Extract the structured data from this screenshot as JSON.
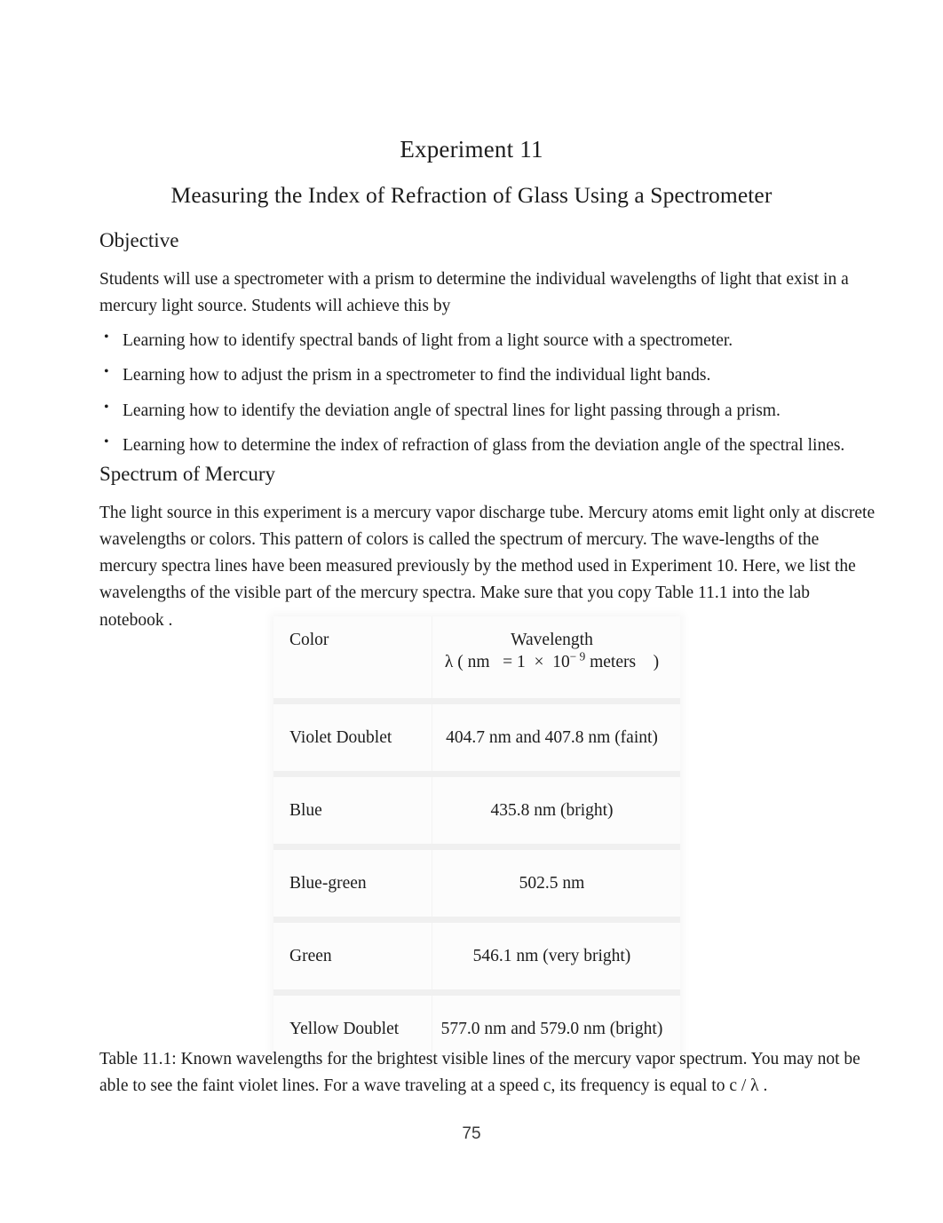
{
  "document": {
    "experiment_title": "Experiment 11",
    "title": "Measuring the Index of Refraction of Glass Using a Spectrometer",
    "page_number": "75"
  },
  "objective": {
    "heading": "Objective",
    "intro": "Students will use a spectrometer with a prism to determine the individual wavelengths of light that exist in a mercury light source. Students will achieve this by",
    "bullets": [
      "Learning how to identify spectral bands of light from a light source with a spectrometer.",
      "Learning how to adjust the prism in a spectrometer to find the individual light bands.",
      "Learning how to identify the deviation angle of spectral lines for light passing through a prism.",
      "Learning how to determine the index of refraction of glass from the deviation angle of the spectral lines."
    ]
  },
  "spectrum": {
    "heading": "Spectrum of Mercury",
    "paragraph": "The light source in this experiment is a mercury vapor discharge tube. Mercury atoms emit light only at discrete wavelengths or colors. This pattern of colors is called the spectrum of mercury. The wave-lengths of the mercury spectra lines have been measured previously by the method used in Experiment 10. Here, we list the wavelengths of the visible part of the mercury spectra. Make sure that you copy Table 11.1 into the lab notebook   ."
  },
  "table": {
    "header": {
      "color": "Color",
      "wavelength_line1": "Wavelength",
      "wavelength_line2_pre": "λ ( nm   = 1  ×  10",
      "wavelength_line2_exp": "− 9",
      "wavelength_line2_post": " meters    )"
    },
    "rows": [
      {
        "color": "Violet Doublet",
        "wavelength": "404.7 nm  and 407.8 nm  (faint)"
      },
      {
        "color": "Blue",
        "wavelength": "435.8 nm  (bright)"
      },
      {
        "color": "Blue-green",
        "wavelength": "502.5 nm"
      },
      {
        "color": "Green",
        "wavelength": "546.1 nm  (very bright)"
      },
      {
        "color": "Yellow Doublet",
        "wavelength": "577.0 nm  and 579.0 nm  (bright)"
      }
    ],
    "caption": "Table 11.1: Known wavelengths for the brightest visible lines of the mercury vapor spectrum. You may not be able to see the faint violet lines. For a wave traveling at a speed c, its frequency is equal to c / λ ."
  }
}
